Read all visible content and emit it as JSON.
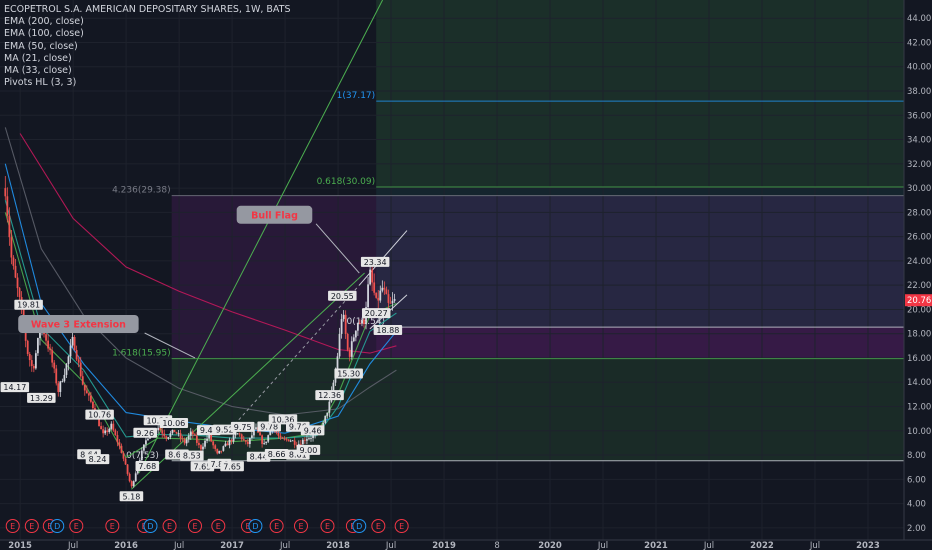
{
  "header": {
    "title": "ECOPETROL S.A. AMERICAN DEPOSITARY SHARES, 1W, BATS",
    "indicators": [
      "EMA (200, close)",
      "EMA (100, close)",
      "EMA (50, close)",
      "MA (21, close)",
      "MA (33, close)",
      "Pivots HL (3, 3)"
    ]
  },
  "colors": {
    "background": "#131722",
    "candle_up": "#d1d4dc",
    "candle_down": "#ef5350",
    "ema200": "#c2185b",
    "ema100": "#5d606b",
    "ema50": "#2196f3",
    "ma21": "#4caf50",
    "ma33": "#26a69a",
    "price_tag": "#f23645"
  },
  "chart_data": {
    "type": "candlestick",
    "title": "ECOPETROL S.A. AMERICAN DEPOSITARY SHARES, 1W, BATS",
    "y_axis": {
      "ylim": [
        1.0,
        45.5
      ],
      "ticks": [
        "2.00",
        "4.00",
        "6.00",
        "8.00",
        "10.00",
        "12.00",
        "14.00",
        "16.00",
        "18.00",
        "20.00",
        "22.00",
        "24.00",
        "26.00",
        "28.00",
        "30.00",
        "32.00",
        "34.00",
        "36.00",
        "38.00",
        "40.00",
        "42.00",
        "44.00"
      ],
      "position": "right"
    },
    "x_axis": {
      "range": [
        "2014-11",
        "2023-04"
      ],
      "ticks": [
        {
          "label": "2015",
          "t": 2015.0
        },
        {
          "label": "Jul",
          "t": 2015.5
        },
        {
          "label": "2016",
          "t": 2016.0
        },
        {
          "label": "Jul",
          "t": 2016.5
        },
        {
          "label": "2017",
          "t": 2017.0
        },
        {
          "label": "Jul",
          "t": 2017.5
        },
        {
          "label": "2018",
          "t": 2018.0
        },
        {
          "label": "Jul",
          "t": 2018.5
        },
        {
          "label": "2019",
          "t": 2019.0
        },
        {
          "label": "8",
          "t": 2019.5
        },
        {
          "label": "2020",
          "t": 2020.0
        },
        {
          "label": "Jul",
          "t": 2020.5
        },
        {
          "label": "2021",
          "t": 2021.0
        },
        {
          "label": "Jul",
          "t": 2021.5
        },
        {
          "label": "2022",
          "t": 2022.0
        },
        {
          "label": "Jul",
          "t": 2022.5
        },
        {
          "label": "2023",
          "t": 2023.0
        }
      ]
    },
    "price_path": [
      {
        "t": 2014.86,
        "v": 30.0
      },
      {
        "t": 2014.92,
        "v": 24.0
      },
      {
        "t": 2015.0,
        "v": 20.5
      },
      {
        "t": 2015.07,
        "v": 16.5
      },
      {
        "t": 2015.12,
        "v": 15.0
      },
      {
        "t": 2015.2,
        "v": 18.9
      },
      {
        "t": 2015.28,
        "v": 16.5
      },
      {
        "t": 2015.36,
        "v": 13.3
      },
      {
        "t": 2015.44,
        "v": 15.5
      },
      {
        "t": 2015.5,
        "v": 17.6
      },
      {
        "t": 2015.6,
        "v": 13.5
      },
      {
        "t": 2015.7,
        "v": 11.8
      },
      {
        "t": 2015.78,
        "v": 9.6
      },
      {
        "t": 2015.86,
        "v": 10.4
      },
      {
        "t": 2015.96,
        "v": 8.2
      },
      {
        "t": 2016.05,
        "v": 5.3
      },
      {
        "t": 2016.12,
        "v": 7.5
      },
      {
        "t": 2016.2,
        "v": 9.5
      },
      {
        "t": 2016.3,
        "v": 10.3
      },
      {
        "t": 2016.38,
        "v": 9.5
      },
      {
        "t": 2016.46,
        "v": 10.0
      },
      {
        "t": 2016.55,
        "v": 9.0
      },
      {
        "t": 2016.62,
        "v": 9.9
      },
      {
        "t": 2016.7,
        "v": 8.5
      },
      {
        "t": 2016.78,
        "v": 9.6
      },
      {
        "t": 2016.86,
        "v": 8.0
      },
      {
        "t": 2016.96,
        "v": 9.0
      },
      {
        "t": 2017.06,
        "v": 9.8
      },
      {
        "t": 2017.14,
        "v": 8.8
      },
      {
        "t": 2017.22,
        "v": 10.2
      },
      {
        "t": 2017.3,
        "v": 8.8
      },
      {
        "t": 2017.38,
        "v": 10.4
      },
      {
        "t": 2017.46,
        "v": 9.2
      },
      {
        "t": 2017.54,
        "v": 9.3
      },
      {
        "t": 2017.62,
        "v": 8.9
      },
      {
        "t": 2017.7,
        "v": 9.4
      },
      {
        "t": 2017.78,
        "v": 9.6
      },
      {
        "t": 2017.86,
        "v": 10.5
      },
      {
        "t": 2017.92,
        "v": 12.3
      },
      {
        "t": 2017.98,
        "v": 15.0
      },
      {
        "t": 2018.04,
        "v": 20.0
      },
      {
        "t": 2018.1,
        "v": 16.0
      },
      {
        "t": 2018.18,
        "v": 19.0
      },
      {
        "t": 2018.24,
        "v": 18.8
      },
      {
        "t": 2018.3,
        "v": 23.0
      },
      {
        "t": 2018.36,
        "v": 20.5
      },
      {
        "t": 2018.42,
        "v": 21.8
      },
      {
        "t": 2018.48,
        "v": 20.2
      },
      {
        "t": 2018.54,
        "v": 20.76
      }
    ],
    "moving_averages": [
      {
        "name": "EMA (200, close)",
        "points": [
          {
            "t": 2015.0,
            "v": 34.5
          },
          {
            "t": 2015.5,
            "v": 27.5
          },
          {
            "t": 2016.0,
            "v": 23.5
          },
          {
            "t": 2016.5,
            "v": 21.5
          },
          {
            "t": 2017.0,
            "v": 19.8
          },
          {
            "t": 2017.5,
            "v": 18.3
          },
          {
            "t": 2018.0,
            "v": 16.7
          },
          {
            "t": 2018.3,
            "v": 16.4
          },
          {
            "t": 2018.55,
            "v": 17.0
          }
        ]
      },
      {
        "name": "EMA (100, close)",
        "points": [
          {
            "t": 2014.86,
            "v": 35.0
          },
          {
            "t": 2015.2,
            "v": 25.0
          },
          {
            "t": 2015.6,
            "v": 19.5
          },
          {
            "t": 2016.0,
            "v": 16.0
          },
          {
            "t": 2016.5,
            "v": 13.5
          },
          {
            "t": 2017.0,
            "v": 12.0
          },
          {
            "t": 2017.5,
            "v": 11.3
          },
          {
            "t": 2018.0,
            "v": 11.8
          },
          {
            "t": 2018.3,
            "v": 13.6
          },
          {
            "t": 2018.55,
            "v": 15.0
          }
        ]
      },
      {
        "name": "EMA (50, close)",
        "points": [
          {
            "t": 2014.86,
            "v": 32.0
          },
          {
            "t": 2015.2,
            "v": 20.5
          },
          {
            "t": 2015.6,
            "v": 15.5
          },
          {
            "t": 2016.0,
            "v": 11.5
          },
          {
            "t": 2016.5,
            "v": 10.8
          },
          {
            "t": 2017.0,
            "v": 10.2
          },
          {
            "t": 2017.5,
            "v": 9.8
          },
          {
            "t": 2018.0,
            "v": 11.2
          },
          {
            "t": 2018.3,
            "v": 15.5
          },
          {
            "t": 2018.55,
            "v": 18.2
          }
        ]
      },
      {
        "name": "MA (21, close)",
        "points": [
          {
            "t": 2014.86,
            "v": 28.0
          },
          {
            "t": 2015.2,
            "v": 17.5
          },
          {
            "t": 2015.6,
            "v": 14.0
          },
          {
            "t": 2016.0,
            "v": 7.8
          },
          {
            "t": 2016.3,
            "v": 9.4
          },
          {
            "t": 2016.7,
            "v": 9.3
          },
          {
            "t": 2017.0,
            "v": 9.1
          },
          {
            "t": 2017.5,
            "v": 9.4
          },
          {
            "t": 2017.8,
            "v": 9.8
          },
          {
            "t": 2018.0,
            "v": 13.0
          },
          {
            "t": 2018.3,
            "v": 19.5
          },
          {
            "t": 2018.55,
            "v": 20.5
          }
        ]
      },
      {
        "name": "MA (33, close)",
        "points": [
          {
            "t": 2014.86,
            "v": 29.0
          },
          {
            "t": 2015.2,
            "v": 18.5
          },
          {
            "t": 2015.6,
            "v": 15.0
          },
          {
            "t": 2016.0,
            "v": 9.5
          },
          {
            "t": 2016.3,
            "v": 9.7
          },
          {
            "t": 2016.7,
            "v": 9.6
          },
          {
            "t": 2017.0,
            "v": 9.4
          },
          {
            "t": 2017.5,
            "v": 9.4
          },
          {
            "t": 2017.8,
            "v": 9.6
          },
          {
            "t": 2018.0,
            "v": 12.0
          },
          {
            "t": 2018.3,
            "v": 18.2
          },
          {
            "t": 2018.55,
            "v": 19.7
          }
        ]
      }
    ],
    "pivot_labels": [
      {
        "text": "19.81",
        "t": 2015.08,
        "v": 19.81,
        "pos": "above"
      },
      {
        "text": "17.92",
        "t": 2015.35,
        "v": 17.92,
        "pos": "above"
      },
      {
        "text": "14.17",
        "t": 2014.95,
        "v": 14.17,
        "pos": "below"
      },
      {
        "text": "13.29",
        "t": 2015.2,
        "v": 13.29,
        "pos": "below"
      },
      {
        "text": "10.76",
        "t": 2015.75,
        "v": 10.76,
        "pos": "above"
      },
      {
        "text": "8.64",
        "t": 2015.65,
        "v": 8.64,
        "pos": "below"
      },
      {
        "text": "8.24",
        "t": 2015.73,
        "v": 8.24,
        "pos": "below"
      },
      {
        "text": "5.18",
        "t": 2016.05,
        "v": 5.18,
        "pos": "below"
      },
      {
        "text": "7.68",
        "t": 2016.2,
        "v": 7.68,
        "pos": "below"
      },
      {
        "text": "9.26",
        "t": 2016.18,
        "v": 9.26,
        "pos": "above"
      },
      {
        "text": "10.29",
        "t": 2016.3,
        "v": 10.29,
        "pos": "above"
      },
      {
        "text": "10.06",
        "t": 2016.45,
        "v": 10.06,
        "pos": "above"
      },
      {
        "text": "8.62",
        "t": 2016.48,
        "v": 8.62,
        "pos": "below"
      },
      {
        "text": "8.53",
        "t": 2016.62,
        "v": 8.53,
        "pos": "below"
      },
      {
        "text": "9.48",
        "t": 2016.78,
        "v": 9.48,
        "pos": "above"
      },
      {
        "text": "9.52",
        "t": 2016.93,
        "v": 9.52,
        "pos": "above"
      },
      {
        "text": "7.65",
        "t": 2016.72,
        "v": 7.65,
        "pos": "below"
      },
      {
        "text": "7.86",
        "t": 2016.88,
        "v": 7.86,
        "pos": "below"
      },
      {
        "text": "7.65",
        "t": 2017.0,
        "v": 7.65,
        "pos": "below"
      },
      {
        "text": "9.75",
        "t": 2017.1,
        "v": 9.75,
        "pos": "above"
      },
      {
        "text": "9.78",
        "t": 2017.35,
        "v": 9.78,
        "pos": "above"
      },
      {
        "text": "10.36",
        "t": 2017.48,
        "v": 10.36,
        "pos": "above"
      },
      {
        "text": "9.76",
        "t": 2017.62,
        "v": 9.76,
        "pos": "above"
      },
      {
        "text": "9.46",
        "t": 2017.76,
        "v": 9.46,
        "pos": "above"
      },
      {
        "text": "8.44",
        "t": 2017.25,
        "v": 8.44,
        "pos": "below"
      },
      {
        "text": "8.66",
        "t": 2017.42,
        "v": 8.66,
        "pos": "below"
      },
      {
        "text": "8.61",
        "t": 2017.62,
        "v": 8.61,
        "pos": "below"
      },
      {
        "text": "9.00",
        "t": 2017.72,
        "v": 9.0,
        "pos": "below"
      },
      {
        "text": "12.36",
        "t": 2017.92,
        "v": 12.36,
        "pos": "above"
      },
      {
        "text": "20.55",
        "t": 2018.04,
        "v": 20.55,
        "pos": "above"
      },
      {
        "text": "15.30",
        "t": 2018.1,
        "v": 15.3,
        "pos": "below"
      },
      {
        "text": "23.34",
        "t": 2018.35,
        "v": 23.34,
        "pos": "above"
      },
      {
        "text": "20.27",
        "t": 2018.36,
        "v": 20.27,
        "pos": "below"
      },
      {
        "text": "18.88",
        "t": 2018.47,
        "v": 18.88,
        "pos": "below"
      }
    ],
    "fib_levels": [
      {
        "label": "1(37.17)",
        "v": 37.17,
        "color": "#2196f3"
      },
      {
        "label": "0.618(30.09)",
        "v": 30.09,
        "color": "#4caf50"
      },
      {
        "label": "4.236(29.38)",
        "v": 29.38,
        "color": "#787b86"
      },
      {
        "label": "1.618(15.95)",
        "v": 15.95,
        "color": "#4caf50"
      },
      {
        "label": "0(18.54)",
        "v": 18.54,
        "color": "#d1d4dc"
      },
      {
        "label": "0(7.53)",
        "v": 7.53,
        "color": "#d1d4dc"
      }
    ],
    "callouts": [
      {
        "text": "Bull Flag",
        "t": 2017.4,
        "v": 27.8,
        "target_t": 2018.2,
        "target_v": 23.0
      },
      {
        "text": "Wave 3 Extension",
        "t": 2015.55,
        "v": 18.8,
        "target_t": 2016.65,
        "target_v": 16.0
      }
    ],
    "last_price": "20.76",
    "event_markers": [
      {
        "label": "E",
        "t": 2014.93
      },
      {
        "label": "E",
        "t": 2015.11
      },
      {
        "label": "E",
        "t": 2015.28
      },
      {
        "label": "D",
        "t": 2015.35
      },
      {
        "label": "E",
        "t": 2015.53
      },
      {
        "label": "E",
        "t": 2015.87
      },
      {
        "label": "E",
        "t": 2016.17
      },
      {
        "label": "D",
        "t": 2016.23
      },
      {
        "label": "E",
        "t": 2016.41
      },
      {
        "label": "E",
        "t": 2016.65
      },
      {
        "label": "E",
        "t": 2016.87
      },
      {
        "label": "E",
        "t": 2017.15
      },
      {
        "label": "D",
        "t": 2017.22
      },
      {
        "label": "E",
        "t": 2017.42
      },
      {
        "label": "E",
        "t": 2017.65
      },
      {
        "label": "E",
        "t": 2017.9
      },
      {
        "label": "E",
        "t": 2018.14
      },
      {
        "label": "D",
        "t": 2018.2
      },
      {
        "label": "E",
        "t": 2018.38
      },
      {
        "label": "E",
        "t": 2018.6
      }
    ]
  }
}
